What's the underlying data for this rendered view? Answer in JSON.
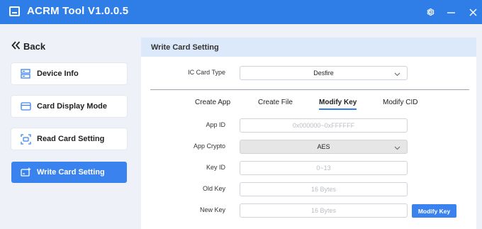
{
  "window": {
    "title": "ACRM Tool V1.0.0.5"
  },
  "sidebar": {
    "back_label": "Back",
    "items": [
      {
        "label": "Device Info",
        "icon": "device-info-icon",
        "active": false
      },
      {
        "label": "Card Display Mode",
        "icon": "card-display-icon",
        "active": false
      },
      {
        "label": "Read Card Setting",
        "icon": "read-card-icon",
        "active": false
      },
      {
        "label": "Write Card Setting",
        "icon": "write-card-icon",
        "active": true
      }
    ]
  },
  "panel": {
    "title": "Write Card Setting",
    "card_type": {
      "label": "IC Card Type",
      "value": "Desfire"
    },
    "tabs": [
      {
        "label": "Create App",
        "active": false
      },
      {
        "label": "Create File",
        "active": false
      },
      {
        "label": "Modify Key",
        "active": true
      },
      {
        "label": "Modify CID",
        "active": false
      }
    ],
    "fields": {
      "app_id": {
        "label": "App ID",
        "placeholder": "0x000000~0xFFFFFF"
      },
      "app_crypto": {
        "label": "App Crypto",
        "value": "AES"
      },
      "key_id": {
        "label": "Key ID",
        "placeholder": "0~13"
      },
      "old_key": {
        "label": "Old Key",
        "placeholder": "16 Bytes"
      },
      "new_key": {
        "label": "New Key",
        "placeholder": "16 Bytes"
      }
    },
    "action_button": "Modify Key"
  },
  "colors": {
    "accent": "#2f7ee8",
    "active_item": "#3a83ee",
    "panel_header": "#dce9fb"
  }
}
